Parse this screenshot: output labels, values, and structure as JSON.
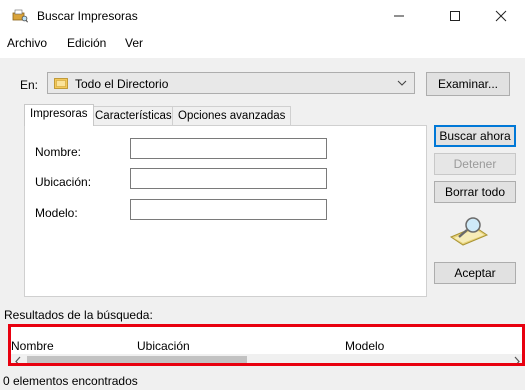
{
  "window": {
    "title": "Buscar Impresoras"
  },
  "menu": [
    {
      "label": "Archivo"
    },
    {
      "label": "Edición"
    },
    {
      "label": "Ver"
    }
  ],
  "scope": {
    "label": "En:",
    "value": "Todo el Directorio",
    "browse_label": "Examinar..."
  },
  "tabs": [
    {
      "label": "Impresoras",
      "active": true
    },
    {
      "label": "Características",
      "active": false
    },
    {
      "label": "Opciones avanzadas",
      "active": false
    }
  ],
  "fields": [
    {
      "label": "Nombre:",
      "value": ""
    },
    {
      "label": "Ubicación:",
      "value": ""
    },
    {
      "label": "Modelo:",
      "value": ""
    }
  ],
  "actions": {
    "search": "Buscar ahora",
    "stop": "Detener",
    "clear": "Borrar todo",
    "ok": "Aceptar"
  },
  "results": {
    "label": "Resultados de la búsqueda:",
    "columns": [
      "Nombre",
      "Ubicación",
      "Modelo"
    ],
    "rows": []
  },
  "status": "0 elementos encontrados",
  "colors": {
    "highlight_border": "#e8000f",
    "default_button_border": "#0078d7"
  }
}
